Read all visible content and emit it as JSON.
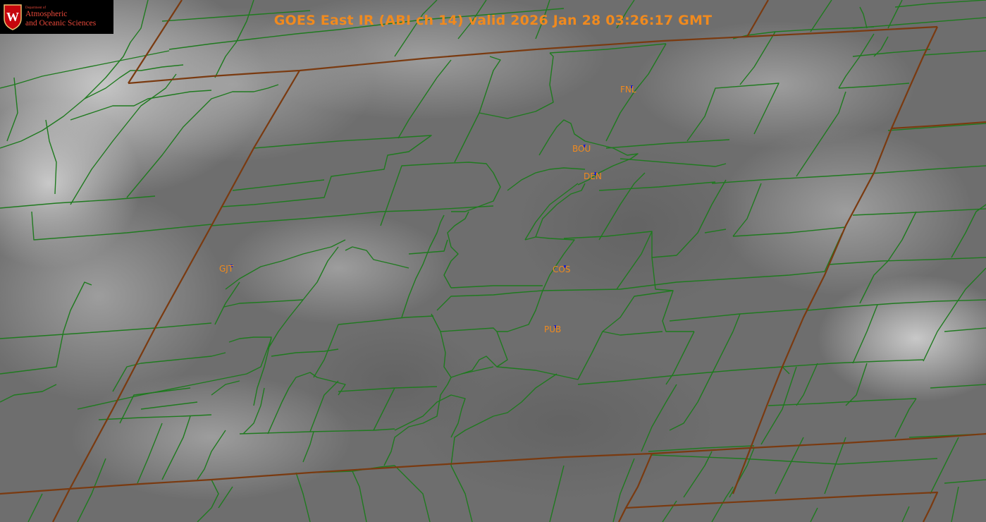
{
  "title": "GOES East IR (ABI ch 14) valid 2026 Jan 28 03:26:17 GMT",
  "logo": {
    "crest_letter": "W",
    "dept": "Department of",
    "line1": "Atmospheric",
    "line2": "and Oceanic Sciences"
  },
  "stations": [
    {
      "code": "FNL"
    },
    {
      "code": "BOU"
    },
    {
      "code": "DEN"
    },
    {
      "code": "GJT"
    },
    {
      "code": "COS"
    },
    {
      "code": "PUB"
    }
  ],
  "colors": {
    "county_lines": "#1f7a1f",
    "state_lines": "#7a3a10",
    "label": "#f08a1e",
    "station_marker": "#1a22c8",
    "logo_red": "#e8483a"
  }
}
